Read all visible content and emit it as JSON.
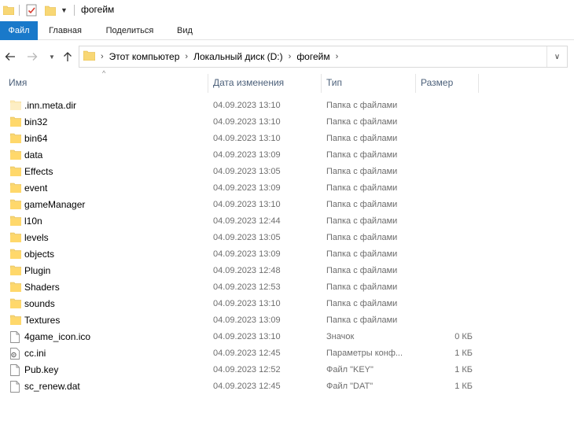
{
  "window": {
    "title": "фогейм"
  },
  "quick_access": {
    "folder_icon": "folder-icon",
    "properties_icon": "properties-check-icon",
    "new_folder_icon": "new-folder-icon",
    "customize_icon": "customize-toolbar-icon"
  },
  "ribbon": {
    "tabs": [
      {
        "label": "Файл",
        "active": true
      },
      {
        "label": "Главная"
      },
      {
        "label": "Поделиться"
      },
      {
        "label": "Вид"
      }
    ],
    "accent_color": "#1979ca"
  },
  "address": {
    "crumbs": [
      "Этот компьютер",
      "Локальный диск (D:)",
      "фогейм"
    ]
  },
  "columns": {
    "name": "Имя",
    "date": "Дата изменения",
    "type": "Тип",
    "size": "Размер"
  },
  "files": [
    {
      "name": ".inn.meta.dir",
      "date": "04.09.2023 13:10",
      "type": "Папка с файлами",
      "size": "",
      "icon": "folder-faded-icon"
    },
    {
      "name": "bin32",
      "date": "04.09.2023 13:10",
      "type": "Папка с файлами",
      "size": "",
      "icon": "folder-icon"
    },
    {
      "name": "bin64",
      "date": "04.09.2023 13:10",
      "type": "Папка с файлами",
      "size": "",
      "icon": "folder-icon"
    },
    {
      "name": "data",
      "date": "04.09.2023 13:09",
      "type": "Папка с файлами",
      "size": "",
      "icon": "folder-icon"
    },
    {
      "name": "Effects",
      "date": "04.09.2023 13:05",
      "type": "Папка с файлами",
      "size": "",
      "icon": "folder-icon"
    },
    {
      "name": "event",
      "date": "04.09.2023 13:09",
      "type": "Папка с файлами",
      "size": "",
      "icon": "folder-icon"
    },
    {
      "name": "gameManager",
      "date": "04.09.2023 13:10",
      "type": "Папка с файлами",
      "size": "",
      "icon": "folder-icon"
    },
    {
      "name": "l10n",
      "date": "04.09.2023 12:44",
      "type": "Папка с файлами",
      "size": "",
      "icon": "folder-icon"
    },
    {
      "name": "levels",
      "date": "04.09.2023 13:05",
      "type": "Папка с файлами",
      "size": "",
      "icon": "folder-icon"
    },
    {
      "name": "objects",
      "date": "04.09.2023 13:09",
      "type": "Папка с файлами",
      "size": "",
      "icon": "folder-icon"
    },
    {
      "name": "Plugin",
      "date": "04.09.2023 12:48",
      "type": "Папка с файлами",
      "size": "",
      "icon": "folder-icon"
    },
    {
      "name": "Shaders",
      "date": "04.09.2023 12:53",
      "type": "Папка с файлами",
      "size": "",
      "icon": "folder-icon"
    },
    {
      "name": "sounds",
      "date": "04.09.2023 13:10",
      "type": "Папка с файлами",
      "size": "",
      "icon": "folder-icon"
    },
    {
      "name": "Textures",
      "date": "04.09.2023 13:09",
      "type": "Папка с файлами",
      "size": "",
      "icon": "folder-icon"
    },
    {
      "name": "4game_icon.ico",
      "date": "04.09.2023 13:10",
      "type": "Значок",
      "size": "0 КБ",
      "icon": "file-icon"
    },
    {
      "name": "cc.ini",
      "date": "04.09.2023 12:45",
      "type": "Параметры конф...",
      "size": "1 КБ",
      "icon": "settings-file-icon"
    },
    {
      "name": "Pub.key",
      "date": "04.09.2023 12:52",
      "type": "Файл \"KEY\"",
      "size": "1 КБ",
      "icon": "file-icon"
    },
    {
      "name": "sc_renew.dat",
      "date": "04.09.2023 12:45",
      "type": "Файл \"DAT\"",
      "size": "1 КБ",
      "icon": "file-icon"
    }
  ]
}
